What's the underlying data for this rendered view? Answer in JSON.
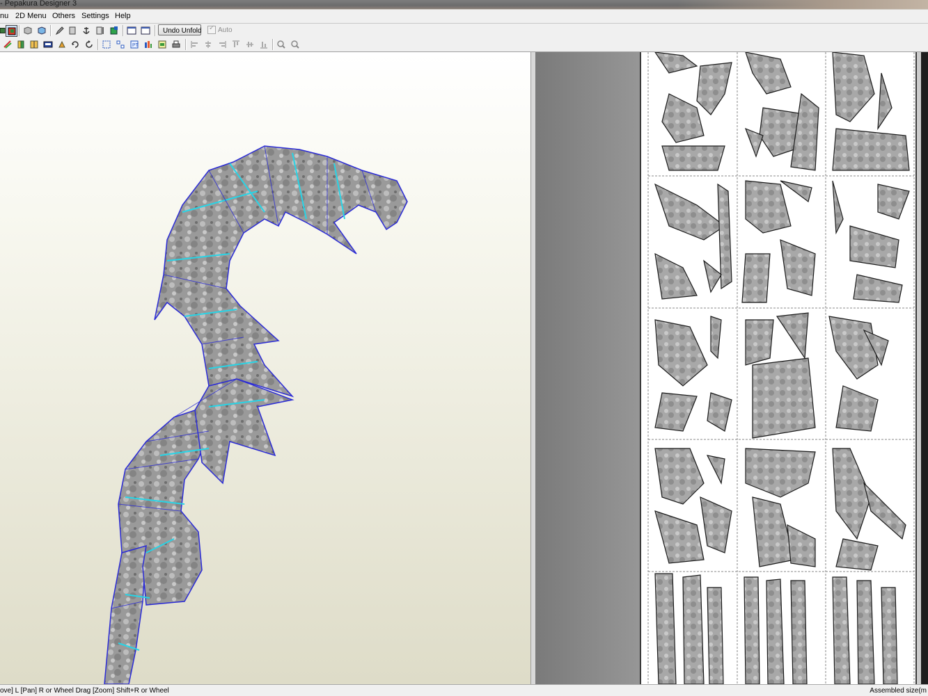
{
  "window": {
    "title": "- Pepakura Designer 3"
  },
  "menu": {
    "items": [
      "nu",
      "2D Menu",
      "Others",
      "Settings",
      "Help"
    ]
  },
  "toolbar": {
    "undo_unfold_label": "Undo Unfold",
    "auto_label": "Auto",
    "row1_icons": [
      "view-mode-icon",
      "texture-icon",
      "box-icon",
      "cube-icon",
      "pencil-icon",
      "cylinder-icon",
      "anchor-icon",
      "panel-icon",
      "green-cube-icon",
      "single-window-icon",
      "split-window-icon"
    ],
    "row2_icons": [
      "edit-edge-icon",
      "join-icon",
      "split-icon",
      "flap-icon",
      "move-icon",
      "rotate-icon",
      "refresh-icon",
      "select-icon",
      "arrange-icon",
      "pattern-icon",
      "layout-icon",
      "page-icon",
      "print-icon",
      "align-left-icon",
      "align-center-icon",
      "align-right-icon",
      "align-top-icon",
      "align-middle-icon",
      "align-bottom-icon",
      "zoom-fit-icon",
      "zoom-page-icon"
    ]
  },
  "status": {
    "left": "ove] L [Pan] R or Wheel Drag [Zoom] Shift+R or Wheel",
    "right": "Assembled size(m"
  },
  "colors": {
    "wire_edge": "#2b2bd6",
    "fold_line": "#28d4e6",
    "paper": "#ffffff"
  }
}
